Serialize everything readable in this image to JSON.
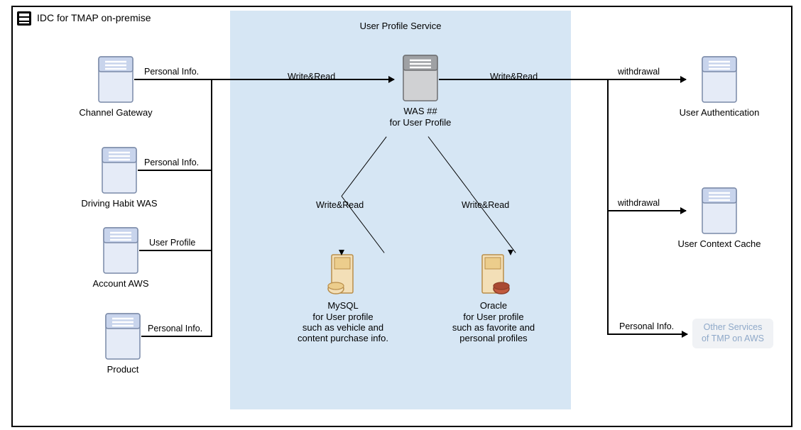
{
  "container_title": "IDC for TMAP on-premise",
  "panel_title": "User Profile Service",
  "left_nodes": {
    "channel_gateway": "Channel Gateway",
    "driving_habit": "Driving Habit  WAS",
    "account_aws": "Account AWS",
    "product": "Product"
  },
  "center_nodes": {
    "was_line1": "WAS ##",
    "was_line2": "for User Profile",
    "mysql_line1": "MySQL",
    "mysql_line2": "for User profile",
    "mysql_line3": "such as vehicle and",
    "mysql_line4": "content purchase info.",
    "oracle_line1": "Oracle",
    "oracle_line2": "for User profile",
    "oracle_line3": "such as favorite and",
    "oracle_line4": "personal profiles"
  },
  "right_nodes": {
    "user_auth": "User Authentication",
    "user_ctx": "User Context Cache",
    "other_line1": "Other Services",
    "other_line2": "of TMP on AWS"
  },
  "flows": {
    "personal_info": "Personal Info.",
    "user_profile": "User Profile",
    "write_read": "Write&Read",
    "withdrawal": "withdrawal"
  }
}
